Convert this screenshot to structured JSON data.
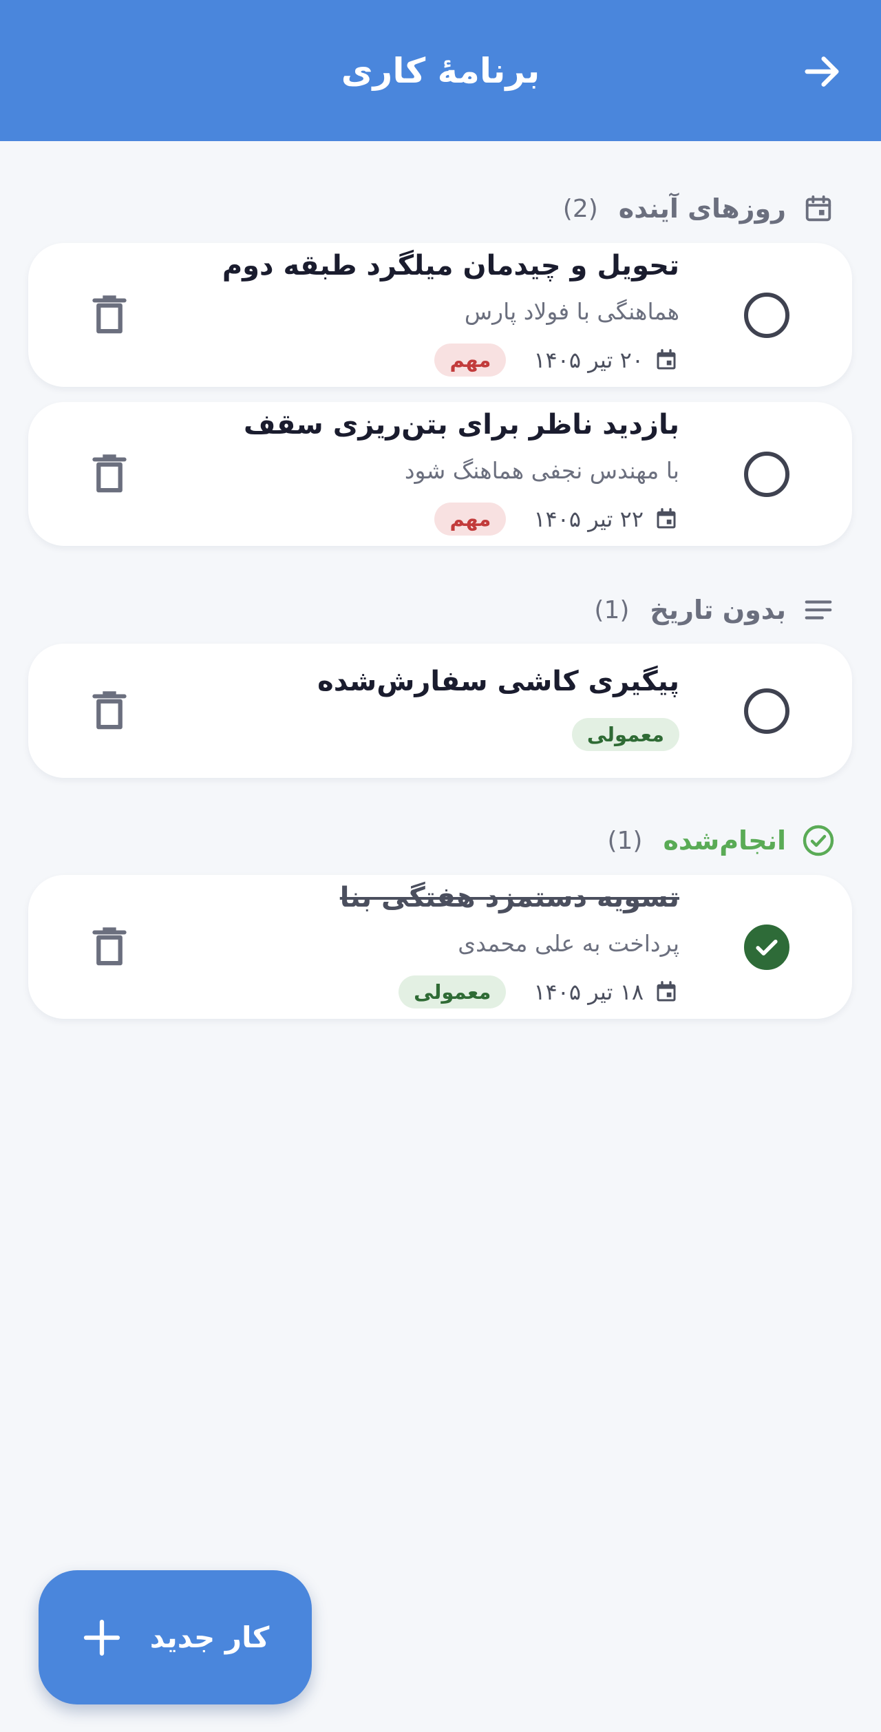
{
  "appbar": {
    "title": "برنامهٔ کاری",
    "back_icon": "arrow-forward-icon"
  },
  "sections": {
    "upcoming": {
      "label": "روزهای آینده",
      "count": "(2)",
      "icon": "calendar-icon"
    },
    "no_date": {
      "label": "بدون تاریخ",
      "count": "(1)",
      "icon": "lines-icon"
    },
    "done": {
      "label": "انجام‌شده",
      "count": "(1)",
      "icon": "check-circle-icon"
    }
  },
  "tasks": [
    {
      "title": "تحویل و چیدمان میلگرد طبقه دوم",
      "note": "هماهنگی با فولاد پارس",
      "date": "۲۰ تیر ۱۴۰۵",
      "priority": "مهم",
      "completed": false
    },
    {
      "title": "بازدید ناظر برای بتن‌ریزی سقف",
      "note": "با مهندس نجفی هماهنگ شود",
      "date": "۲۲ تیر ۱۴۰۵",
      "priority": "مهم",
      "completed": false
    },
    {
      "title": "پیگیری کاشی سفارش‌شده",
      "priority": "معمولی",
      "completed": false
    },
    {
      "title": "تسویه دستمزد هفتگی بنا",
      "note": "پرداخت به علی محمدی",
      "date": "۱۸ تیر ۱۴۰۵",
      "priority": "معمولی",
      "completed": true
    }
  ],
  "fab": {
    "label": "کار جدید",
    "icon": "plus-icon"
  },
  "colors": {
    "primary": "#4a86dc",
    "background": "#f5f7fa",
    "important_bg": "#f8e1e1",
    "important_text": "#c23b3b",
    "normal_bg": "#e3f0e3",
    "normal_text": "#2f6b35",
    "done_green": "#5aab56",
    "checked_fill": "#2e6b38"
  }
}
